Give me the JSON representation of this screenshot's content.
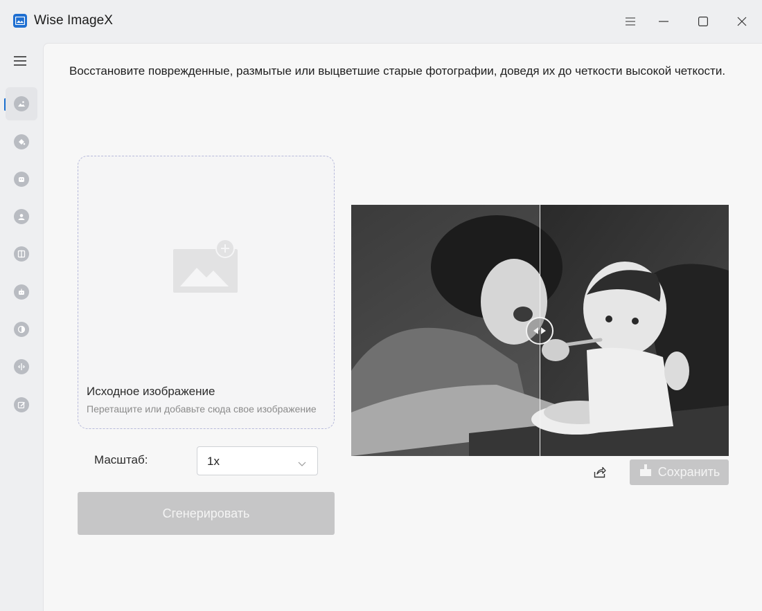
{
  "window": {
    "title": "Wise ImageX",
    "controls": [
      "menu-icon",
      "minimize-icon",
      "maximize-icon",
      "close-icon"
    ]
  },
  "sidebar": {
    "items": [
      {
        "icon": "photo-restore-icon",
        "active": true
      },
      {
        "icon": "color-fill-icon",
        "active": false
      },
      {
        "icon": "face-enhance-icon",
        "active": false
      },
      {
        "icon": "portrait-icon",
        "active": false
      },
      {
        "icon": "compare-split-icon",
        "active": false
      },
      {
        "icon": "ai-robot-icon",
        "active": false
      },
      {
        "icon": "contrast-icon",
        "active": false
      },
      {
        "icon": "denoise-icon",
        "active": false
      },
      {
        "icon": "edit-image-icon",
        "active": false
      }
    ]
  },
  "main": {
    "description": "Восстановите поврежденные, размытые или выцветшие старые фотографии, доведя их до четкости высокой четкости.",
    "dropzone": {
      "title": "Исходное изображение",
      "hint": "Перетащите или добавьте сюда свое изображение"
    },
    "scale": {
      "label": "Масштаб:",
      "value": "1x"
    },
    "generate_label": "Сгенерировать",
    "save_label": "Сохранить"
  },
  "colors": {
    "accent": "#1a6fce",
    "disabled_button": "#c6c6c7",
    "dropzone_border": "#b6b9da"
  }
}
